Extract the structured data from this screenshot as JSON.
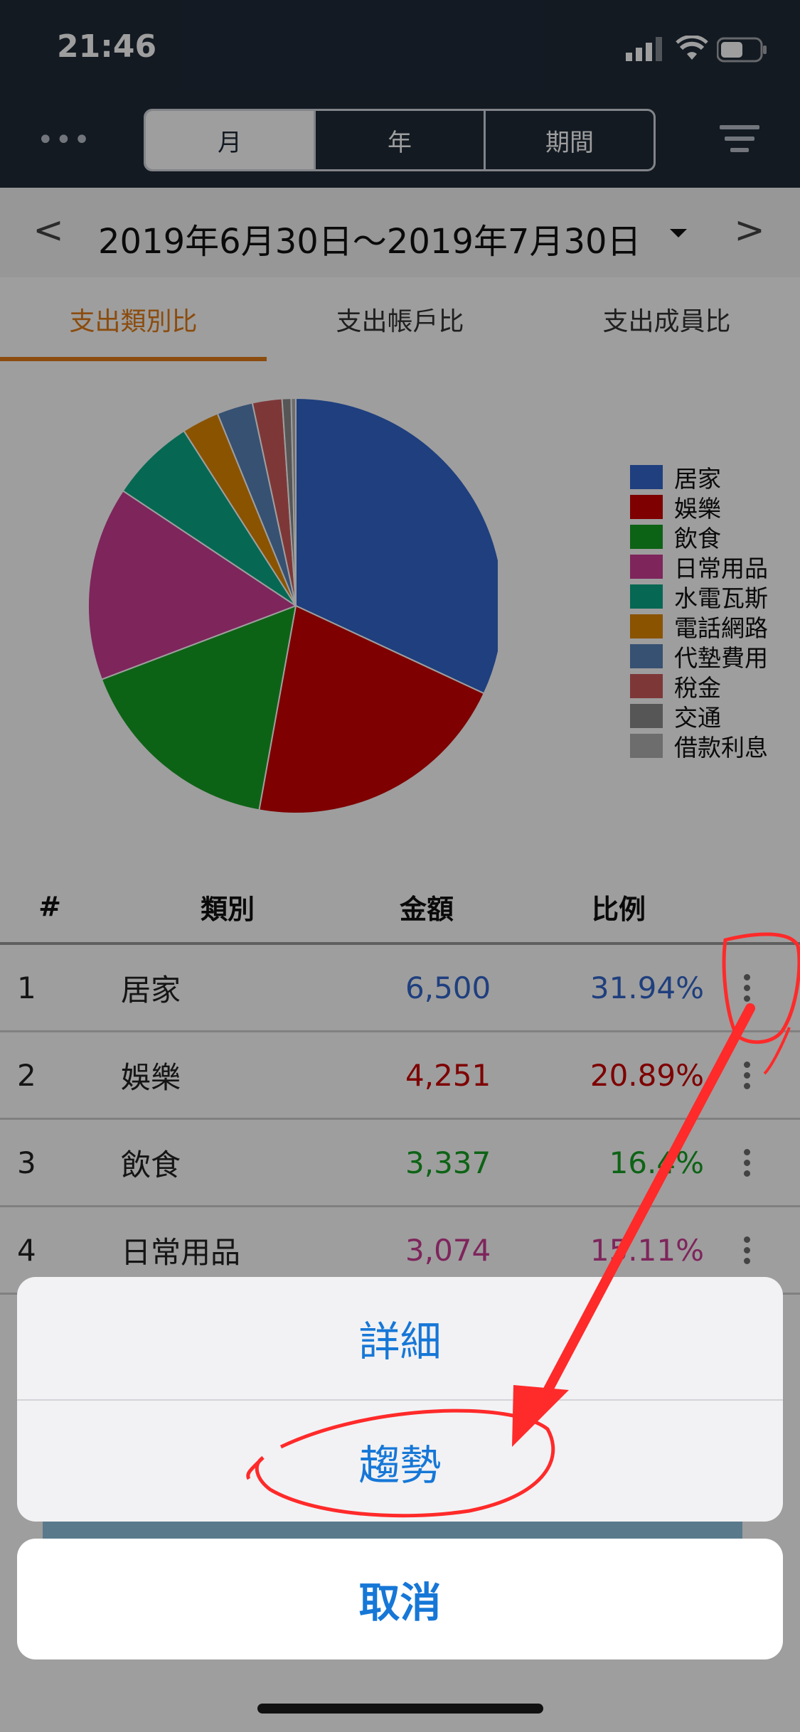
{
  "status_bar": {
    "time": "21:46"
  },
  "header": {
    "more_label": "•••",
    "segments": [
      "月",
      "年",
      "期間"
    ],
    "selected_segment": "月"
  },
  "date_nav": {
    "prev_label": "<",
    "next_label": ">",
    "range": "2019年6月30日～2019年7月30日"
  },
  "tabs": [
    "支出類別比",
    "支出帳戶比",
    "支出成員比"
  ],
  "active_tab": "支出類別比",
  "chart_data": {
    "type": "pie",
    "categories": [
      "居家",
      "娛樂",
      "飲食",
      "日常用品",
      "水電瓦斯",
      "電話網路",
      "代墊費用",
      "稅金",
      "交通",
      "借款利息"
    ],
    "values": [
      31.94,
      20.89,
      16.4,
      15.11,
      6.6,
      2.9,
      2.8,
      2.3,
      0.7,
      0.36
    ],
    "colors": [
      "#3366cc",
      "#cc0000",
      "#16a023",
      "#cc3c95",
      "#0aa887",
      "#df8700",
      "#5a84b8",
      "#cc5a5a",
      "#8c8c8c",
      "#b0b0b0"
    ],
    "legend_position": "right"
  },
  "table": {
    "headers": {
      "num": "#",
      "category": "類別",
      "amount": "金額",
      "ratio": "比例"
    },
    "rows": [
      {
        "num": "1",
        "category": "居家",
        "amount": "6,500",
        "ratio": "31.94%",
        "color": "#3366cc"
      },
      {
        "num": "2",
        "category": "娛樂",
        "amount": "4,251",
        "ratio": "20.89%",
        "color": "#cc0000"
      },
      {
        "num": "3",
        "category": "飲食",
        "amount": "3,337",
        "ratio": "16.4%",
        "color": "#16a023"
      },
      {
        "num": "4",
        "category": "日常用品",
        "amount": "3,074",
        "ratio": "15.11%",
        "color": "#cc3c95"
      }
    ]
  },
  "action_sheet": {
    "items": [
      "詳細",
      "趨勢"
    ],
    "cancel": "取消"
  },
  "colors": {
    "header_bg": "#1f2a38",
    "accent": "#e07b18",
    "ios_blue": "#1677d7",
    "annotation": "#ff2a2a"
  }
}
